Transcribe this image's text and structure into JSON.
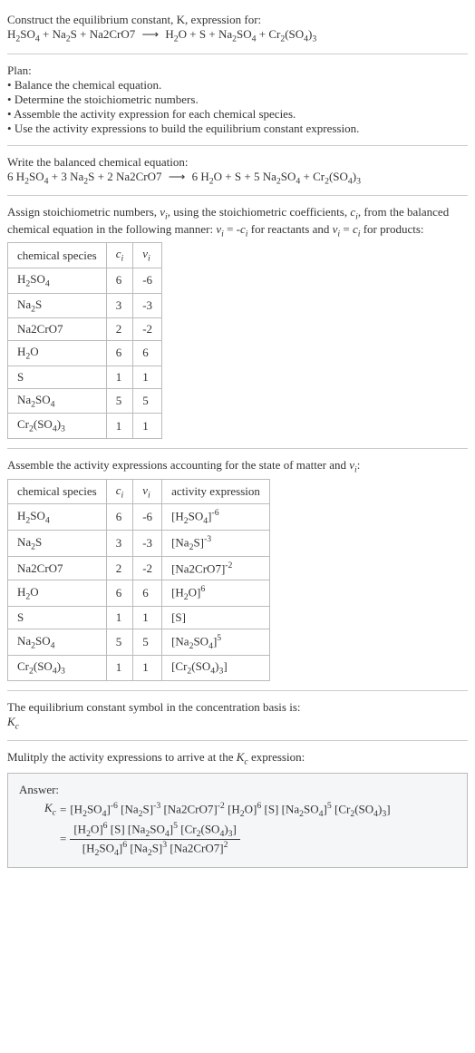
{
  "intro": {
    "line1": "Construct the equilibrium constant, K, expression for:",
    "eqn_lhs": "H₂SO₄ + Na₂S + Na2CrO7",
    "eqn_rhs": "H₂O + S + Na₂SO₄ + Cr₂(SO₄)₃"
  },
  "plan": {
    "heading": "Plan:",
    "items": [
      "Balance the chemical equation.",
      "Determine the stoichiometric numbers.",
      "Assemble the activity expression for each chemical species.",
      "Use the activity expressions to build the equilibrium constant expression."
    ]
  },
  "balanced": {
    "heading": "Write the balanced chemical equation:",
    "lhs": "6 H₂SO₄ + 3 Na₂S + 2 Na2CrO7",
    "rhs": "6 H₂O + S + 5 Na₂SO₄ + Cr₂(SO₄)₃"
  },
  "stoich": {
    "text_a": "Assign stoichiometric numbers, νᵢ, using the stoichiometric coefficients, cᵢ, from the balanced chemical equation in the following manner: νᵢ = -cᵢ for reactants and νᵢ = cᵢ for products:",
    "headers": [
      "chemical species",
      "cᵢ",
      "νᵢ"
    ],
    "rows": [
      [
        "H₂SO₄",
        "6",
        "-6"
      ],
      [
        "Na₂S",
        "3",
        "-3"
      ],
      [
        "Na2CrO7",
        "2",
        "-2"
      ],
      [
        "H₂O",
        "6",
        "6"
      ],
      [
        "S",
        "1",
        "1"
      ],
      [
        "Na₂SO₄",
        "5",
        "5"
      ],
      [
        "Cr₂(SO₄)₃",
        "1",
        "1"
      ]
    ]
  },
  "activity": {
    "text": "Assemble the activity expressions accounting for the state of matter and νᵢ:",
    "headers": [
      "chemical species",
      "cᵢ",
      "νᵢ",
      "activity expression"
    ],
    "rows": [
      [
        "H₂SO₄",
        "6",
        "-6",
        "[H₂SO₄]⁻⁶"
      ],
      [
        "Na₂S",
        "3",
        "-3",
        "[Na₂S]⁻³"
      ],
      [
        "Na2CrO7",
        "2",
        "-2",
        "[Na2CrO7]⁻²"
      ],
      [
        "H₂O",
        "6",
        "6",
        "[H₂O]⁶"
      ],
      [
        "S",
        "1",
        "1",
        "[S]"
      ],
      [
        "Na₂SO₄",
        "5",
        "5",
        "[Na₂SO₄]⁵"
      ],
      [
        "Cr₂(SO₄)₃",
        "1",
        "1",
        "[Cr₂(SO₄)₃]"
      ]
    ]
  },
  "symbol": {
    "line1": "The equilibrium constant symbol in the concentration basis is:",
    "line2": "K_c"
  },
  "multiply": {
    "text": "Mulitply the activity expressions to arrive at the K_c expression:"
  },
  "answer": {
    "label": "Answer:",
    "kc": "K_c",
    "eq": "=",
    "flat": "[H₂SO₄]⁻⁶ [Na₂S]⁻³ [Na2CrO7]⁻² [H₂O]⁶ [S] [Na₂SO₄]⁵ [Cr₂(SO₄)₃]",
    "num": "[H₂O]⁶ [S] [Na₂SO₄]⁵ [Cr₂(SO₄)₃]",
    "den": "[H₂SO₄]⁶ [Na₂S]³ [Na2CrO7]²"
  }
}
